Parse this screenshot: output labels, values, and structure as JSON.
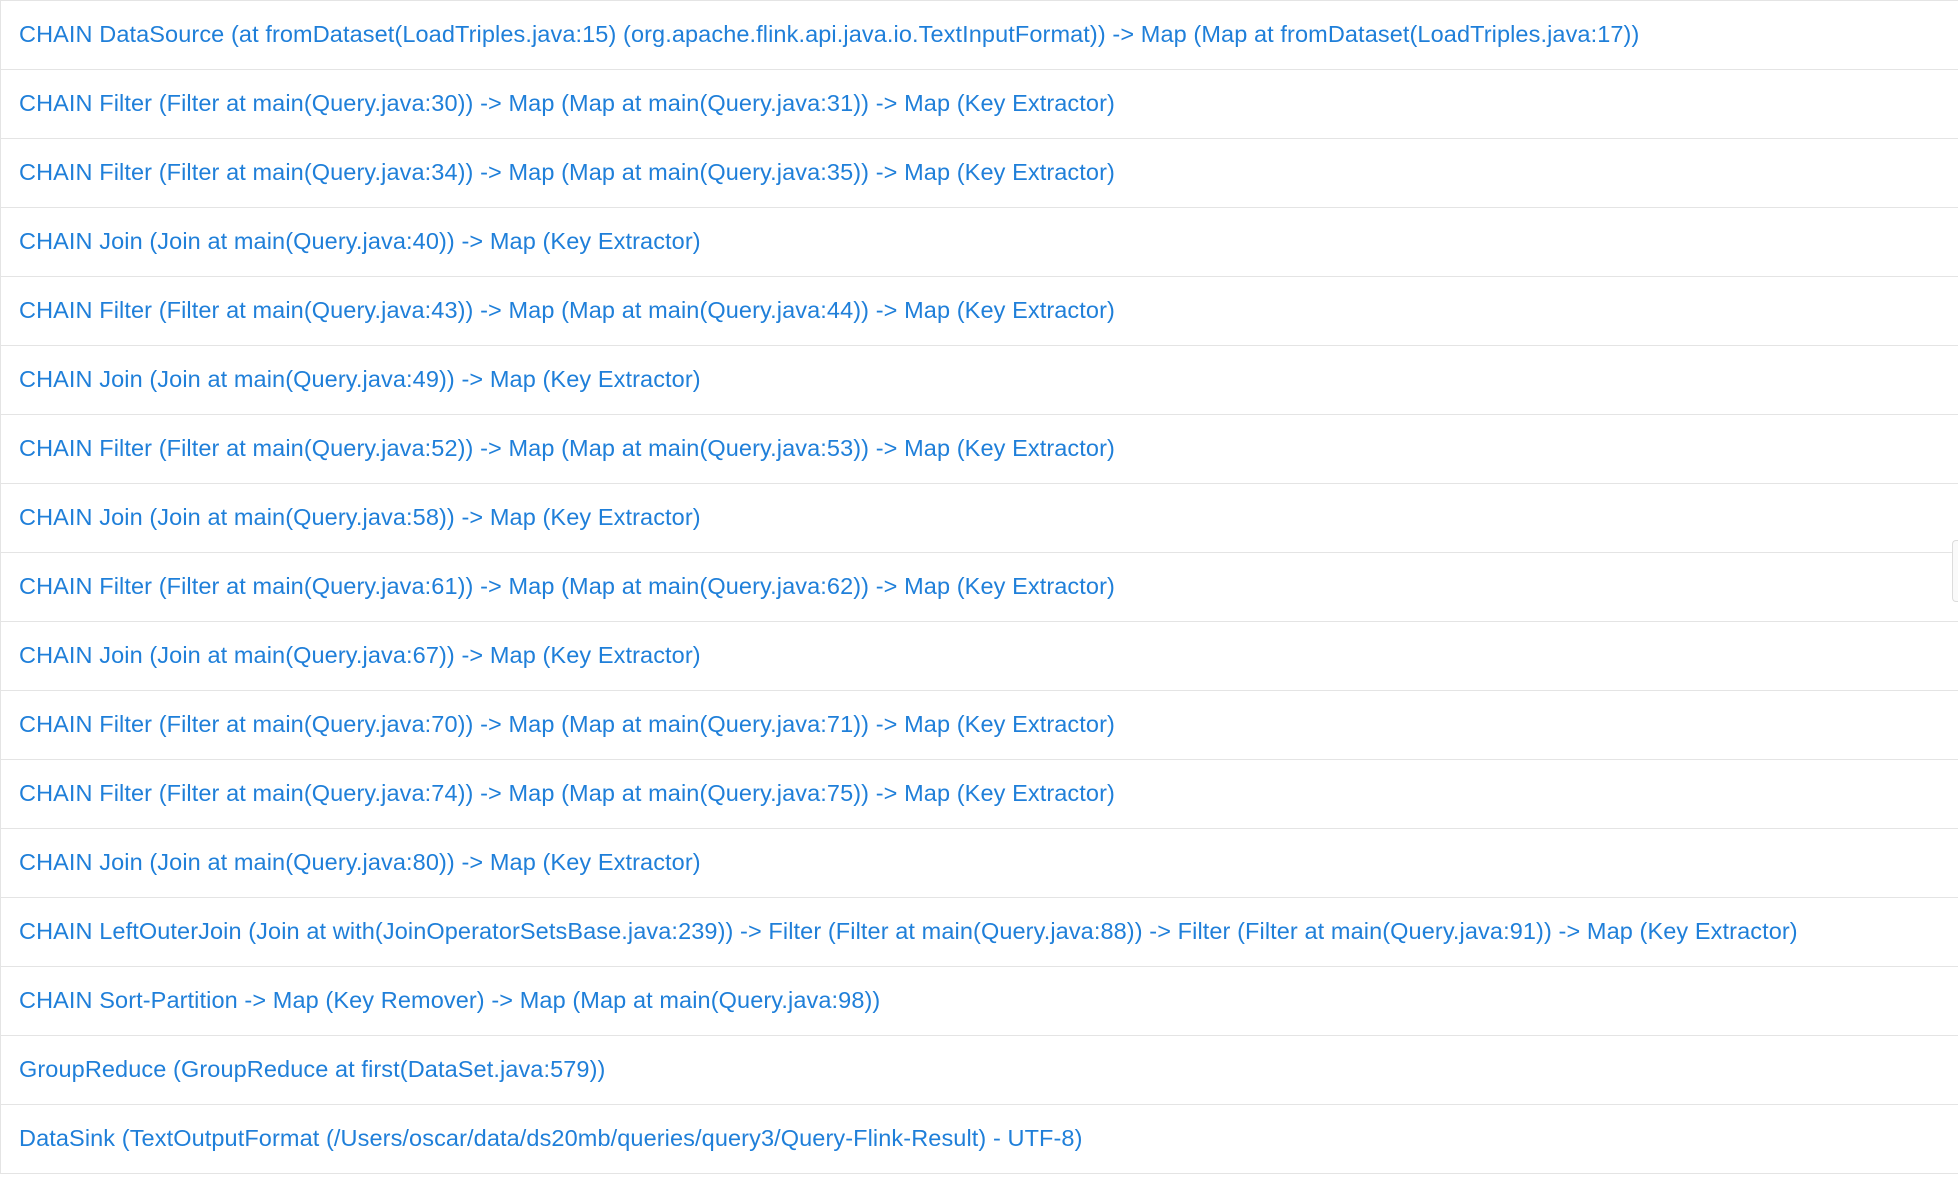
{
  "tasks": [
    {
      "label": "CHAIN DataSource (at fromDataset(LoadTriples.java:15) (org.apache.flink.api.java.io.TextInputFormat)) -> Map (Map at fromDataset(LoadTriples.java:17))"
    },
    {
      "label": "CHAIN Filter (Filter at main(Query.java:30)) -> Map (Map at main(Query.java:31)) -> Map (Key Extractor)"
    },
    {
      "label": "CHAIN Filter (Filter at main(Query.java:34)) -> Map (Map at main(Query.java:35)) -> Map (Key Extractor)"
    },
    {
      "label": "CHAIN Join (Join at main(Query.java:40)) -> Map (Key Extractor)"
    },
    {
      "label": "CHAIN Filter (Filter at main(Query.java:43)) -> Map (Map at main(Query.java:44)) -> Map (Key Extractor)"
    },
    {
      "label": "CHAIN Join (Join at main(Query.java:49)) -> Map (Key Extractor)"
    },
    {
      "label": "CHAIN Filter (Filter at main(Query.java:52)) -> Map (Map at main(Query.java:53)) -> Map (Key Extractor)"
    },
    {
      "label": "CHAIN Join (Join at main(Query.java:58)) -> Map (Key Extractor)"
    },
    {
      "label": "CHAIN Filter (Filter at main(Query.java:61)) -> Map (Map at main(Query.java:62)) -> Map (Key Extractor)"
    },
    {
      "label": "CHAIN Join (Join at main(Query.java:67)) -> Map (Key Extractor)"
    },
    {
      "label": "CHAIN Filter (Filter at main(Query.java:70)) -> Map (Map at main(Query.java:71)) -> Map (Key Extractor)"
    },
    {
      "label": "CHAIN Filter (Filter at main(Query.java:74)) -> Map (Map at main(Query.java:75)) -> Map (Key Extractor)"
    },
    {
      "label": "CHAIN Join (Join at main(Query.java:80)) -> Map (Key Extractor)"
    },
    {
      "label": "CHAIN LeftOuterJoin (Join at with(JoinOperatorSetsBase.java:239)) -> Filter (Filter at main(Query.java:88)) -> Filter (Filter at main(Query.java:91)) -> Map (Key Extractor)"
    },
    {
      "label": "CHAIN Sort-Partition -> Map (Key Remover) -> Map (Map at main(Query.java:98))"
    },
    {
      "label": "GroupReduce (GroupReduce at first(DataSet.java:579))"
    },
    {
      "label": "DataSink (TextOutputFormat (/Users/oscar/data/ds20mb/queries/query3/Query-Flink-Result) - UTF-8)"
    }
  ],
  "colors": {
    "link": "#1f7fd9",
    "row_border": "#e4e4e4",
    "background": "#ffffff"
  }
}
